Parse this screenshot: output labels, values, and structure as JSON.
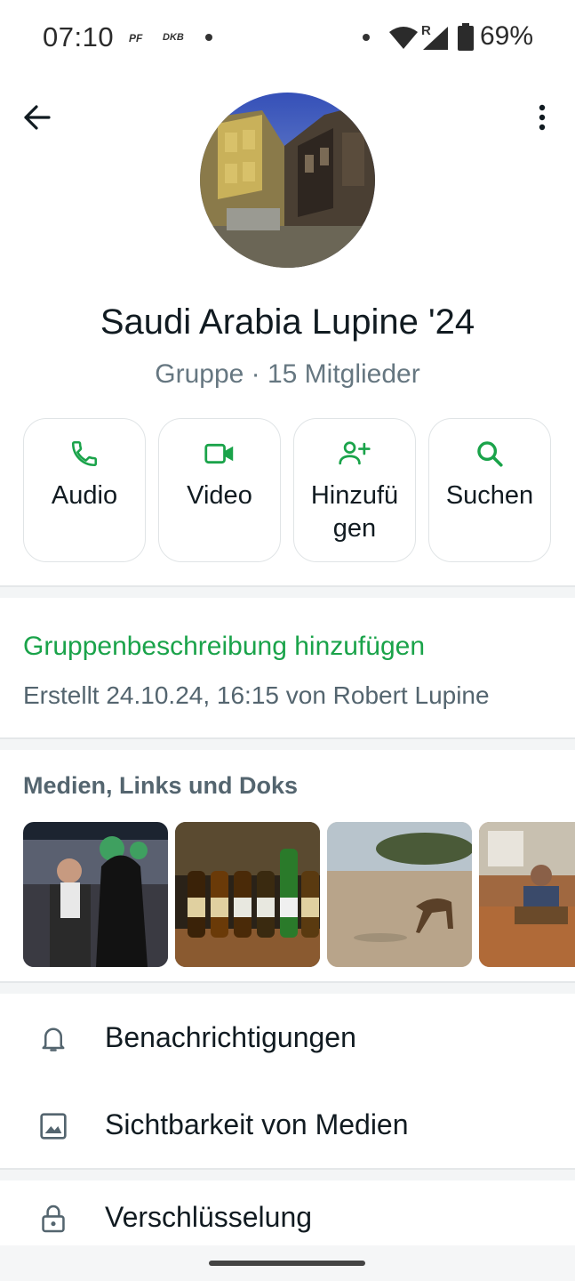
{
  "status_bar": {
    "time": "07:10",
    "carrier_a": "PF",
    "carrier_b": "DKB",
    "roaming": "R",
    "battery": "69%",
    "icons": [
      "wifi-icon",
      "signal-icon",
      "battery-icon"
    ]
  },
  "header": {
    "back_icon": "arrow-left-icon",
    "menu_icon": "more-vert-icon"
  },
  "group": {
    "name": "Saudi Arabia Lupine '24",
    "subtitle": "Gruppe · 15 Mitglieder"
  },
  "actions": [
    {
      "label": "Audio",
      "icon": "phone-icon"
    },
    {
      "label": "Video",
      "icon": "video-icon"
    },
    {
      "label": "Hinzufü gen",
      "icon": "add-person-icon"
    },
    {
      "label": "Suchen",
      "icon": "search-icon"
    }
  ],
  "description": {
    "add_link": "Gruppenbeschreibung hinzufügen",
    "created": "Erstellt 24.10.24, 16:15 von Robert Lupine"
  },
  "media": {
    "title": "Medien, Links und Doks",
    "items": [
      "photo",
      "photo",
      "photo",
      "photo"
    ]
  },
  "settings": [
    {
      "label": "Benachrichtigungen",
      "icon": "bell-icon"
    },
    {
      "label": "Sichtbarkeit von Medien",
      "icon": "image-icon"
    },
    {
      "label": "Verschlüsselung",
      "icon": "lock-icon"
    }
  ],
  "colors": {
    "accent": "#1aa34a",
    "text_primary": "#111b21",
    "text_secondary": "#667781"
  }
}
